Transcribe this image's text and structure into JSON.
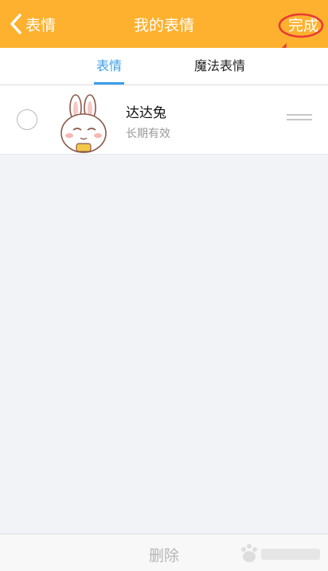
{
  "nav": {
    "back_label": "表情",
    "title": "我的表情",
    "done_label": "完成"
  },
  "tabs": [
    {
      "label": "表情",
      "active": true
    },
    {
      "label": "魔法表情",
      "active": false
    }
  ],
  "items": [
    {
      "name": "达达兔",
      "subtitle": "长期有效",
      "selected": false
    }
  ],
  "bottom": {
    "delete_label": "删除"
  },
  "colors": {
    "navbar": "#fdb12f",
    "tab_active": "#3e9ee8",
    "annotation": "#e83a35"
  }
}
